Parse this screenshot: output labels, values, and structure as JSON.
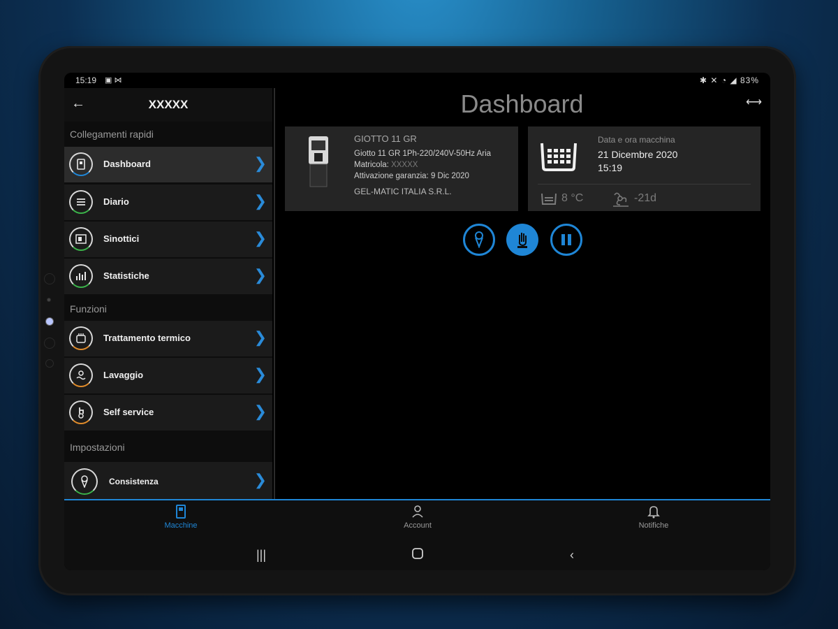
{
  "status_bar": {
    "time": "15:19",
    "battery": "83%"
  },
  "drawer": {
    "title": "XXXXX",
    "sections": {
      "quick_links": "Collegamenti rapidi",
      "functions": "Funzioni",
      "settings": "Impostazioni"
    },
    "items": [
      {
        "label": "Dashboard",
        "icon": "dashboard-icon",
        "active": true
      },
      {
        "label": "Diario",
        "icon": "list-icon"
      },
      {
        "label": "Sinottici",
        "icon": "synoptic-icon"
      },
      {
        "label": "Statistiche",
        "icon": "stats-icon"
      },
      {
        "label": "Trattamento termico",
        "icon": "thermal-icon"
      },
      {
        "label": "Lavaggio",
        "icon": "wash-icon"
      },
      {
        "label": "Self service",
        "icon": "self-service-icon"
      },
      {
        "label": "Consistenza",
        "icon": "ice-cream-icon"
      }
    ]
  },
  "main": {
    "title": "Dashboard",
    "machine_card": {
      "name": "GIOTTO 11 GR",
      "model": "Giotto 11 GR 1Ph-220/240V-50Hz Aria",
      "serial_label": "Matricola:",
      "serial_value": "XXXXX",
      "warranty": "Attivazione garanzia: 9 Dic 2020",
      "company": "GEL-MATIC ITALIA S.R.L."
    },
    "datetime_card": {
      "label": "Data e ora macchina",
      "date": "21 Dicembre 2020",
      "time": "15:19",
      "temperature": "8 °C",
      "fan_value": "-21d"
    },
    "actions": [
      "ice-cream-action",
      "stop-action",
      "pause-action"
    ]
  },
  "tabs": [
    {
      "label": "Macchine",
      "icon": "machine-icon",
      "active": true
    },
    {
      "label": "Account",
      "icon": "user-icon"
    },
    {
      "label": "Notifiche",
      "icon": "bell-icon"
    }
  ],
  "colors": {
    "accent": "#1f86d6",
    "card": "#252525",
    "background": "#000000"
  }
}
